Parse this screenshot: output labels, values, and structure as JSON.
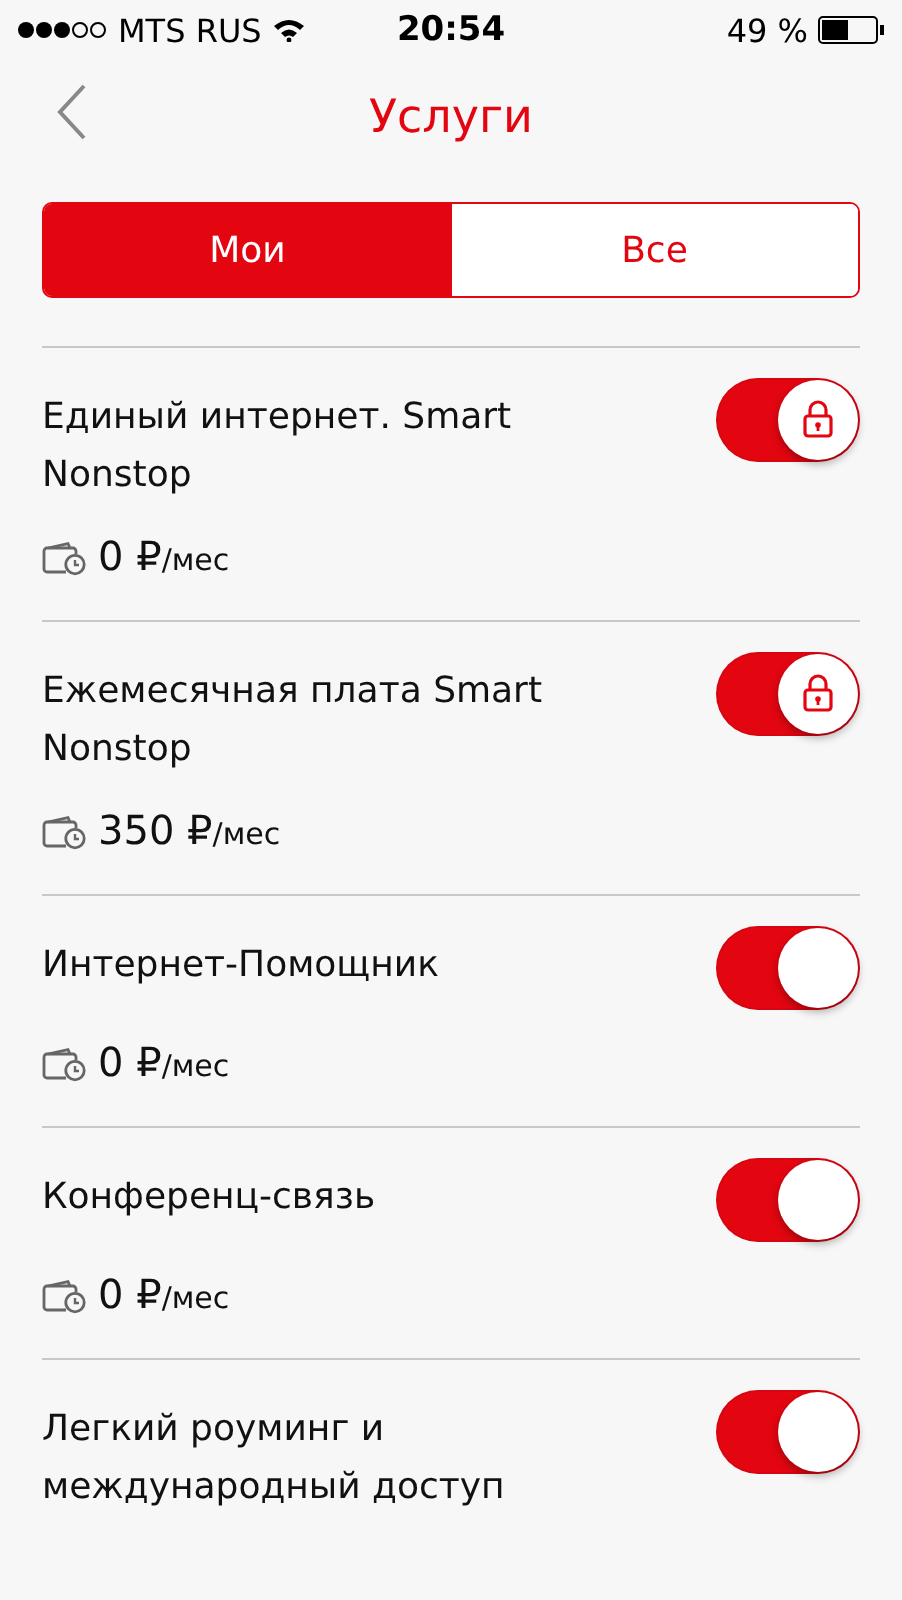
{
  "status_bar": {
    "carrier": "MTS RUS",
    "time": "20:54",
    "battery_text": "49 %"
  },
  "header": {
    "title": "Услуги"
  },
  "tabs": [
    {
      "label": "Мои",
      "selected": true
    },
    {
      "label": "Все",
      "selected": false
    }
  ],
  "services": [
    {
      "name": "Единый интернет. Smart Nonstop",
      "amount": "0 ₽",
      "unit": "/мес",
      "on": true,
      "locked": true
    },
    {
      "name": "Ежемесячная плата Smart Nonstop",
      "amount": "350 ₽",
      "unit": "/мес",
      "on": true,
      "locked": true
    },
    {
      "name": "Интернет-Помощник",
      "amount": "0 ₽",
      "unit": "/мес",
      "on": true,
      "locked": false
    },
    {
      "name": "Конференц-связь",
      "amount": "0 ₽",
      "unit": "/мес",
      "on": true,
      "locked": false
    },
    {
      "name": "Легкий роуминг и международный доступ",
      "on": true,
      "locked": false
    }
  ]
}
